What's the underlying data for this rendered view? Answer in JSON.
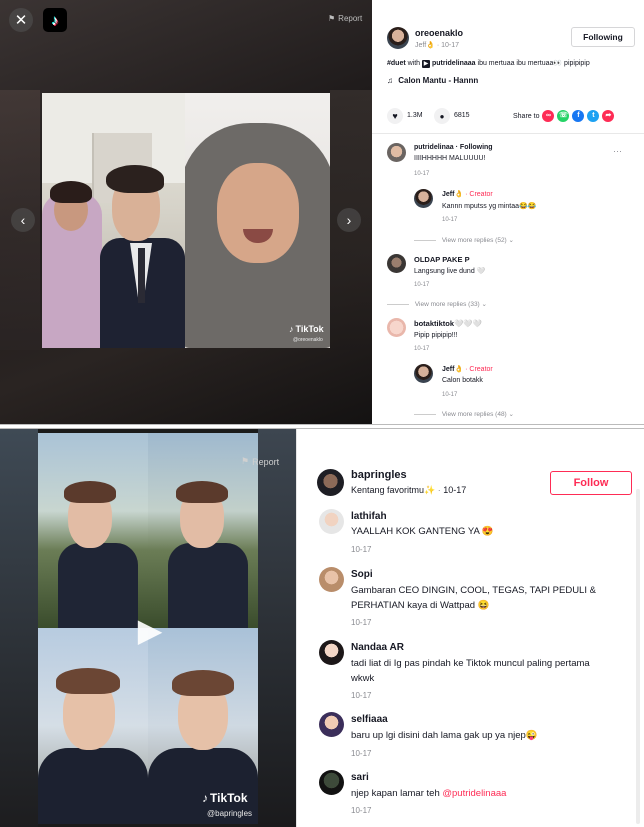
{
  "panel1": {
    "report_label": "Report",
    "video": {
      "watermark_brand": "TikTok",
      "watermark_handle": "@oreoenaklo"
    },
    "author": {
      "username": "oreoenaklo",
      "display": "Jeff👌",
      "date": "10-17",
      "follow_label": "Following"
    },
    "caption": {
      "tag": "#duet",
      "with": "with",
      "mention": "putridelinaaa",
      "text": "ibu mertuaa ibu mertuaa👀 pipipipip"
    },
    "music": "Calon Mantu - Hannn",
    "stats": {
      "likes": "1.3M",
      "comments": "6815"
    },
    "share_label": "Share to",
    "comments": [
      {
        "user": "putridelinaa",
        "badge": "· Following",
        "text": "IIIIHHHHH MALUUUU!",
        "date": "10-17"
      },
      {
        "user": "Jeff👌",
        "badge": "· Creator",
        "text": "Kannn mputss yg mintaa😂😂",
        "date": "10-17"
      },
      {
        "replies": "View more replies (52)"
      },
      {
        "user": "OLDAP PAKE P",
        "text": "Langsung live dund 🤍",
        "date": "10-17"
      },
      {
        "replies": "View more replies (33)"
      },
      {
        "user": "botaktiktok🤍🤍🤍",
        "text": "Pipip pipipip!!!",
        "date": "10-17"
      },
      {
        "user": "Jeff👌",
        "badge": "· Creator",
        "text": "Calon botakk",
        "date": "10-17"
      },
      {
        "replies": "View more replies (48)"
      }
    ]
  },
  "panel2": {
    "report_label": "Report",
    "video": {
      "watermark_brand": "TikTok",
      "watermark_handle": "@bapringles"
    },
    "author": {
      "username": "bapringles",
      "caption": "Kentang favoritmu✨",
      "date": "10-17",
      "follow_label": "Follow"
    },
    "comments": [
      {
        "user": "lathifah",
        "text": "YAALLAH KOK GANTENG YA 😍",
        "date": "10-17"
      },
      {
        "user": "Sopi",
        "text_line1": "Gambaran CEO DINGIN, COOL, TEGAS, TAPI PEDULI &",
        "text_line2": "PERHATIAN kaya di Wattpad 😆",
        "date": "10-17"
      },
      {
        "user": "Nandaa AR",
        "text_line1": "tadi liat di Ig pas pindah ke Tiktok muncul paling pertama",
        "text_line2": "wkwk",
        "date": "10-17"
      },
      {
        "user": "selfiaaa",
        "text": "baru up lgi disini dah lama gak up ya njep😜",
        "date": "10-17"
      },
      {
        "user": "sari",
        "text": "njep kapan lamar teh ",
        "mention": "@putridelinaaa",
        "date": "10-17"
      }
    ]
  },
  "colors": {
    "accent": "#fe2c55",
    "text": "#161823",
    "muted": "#8a8b91"
  }
}
